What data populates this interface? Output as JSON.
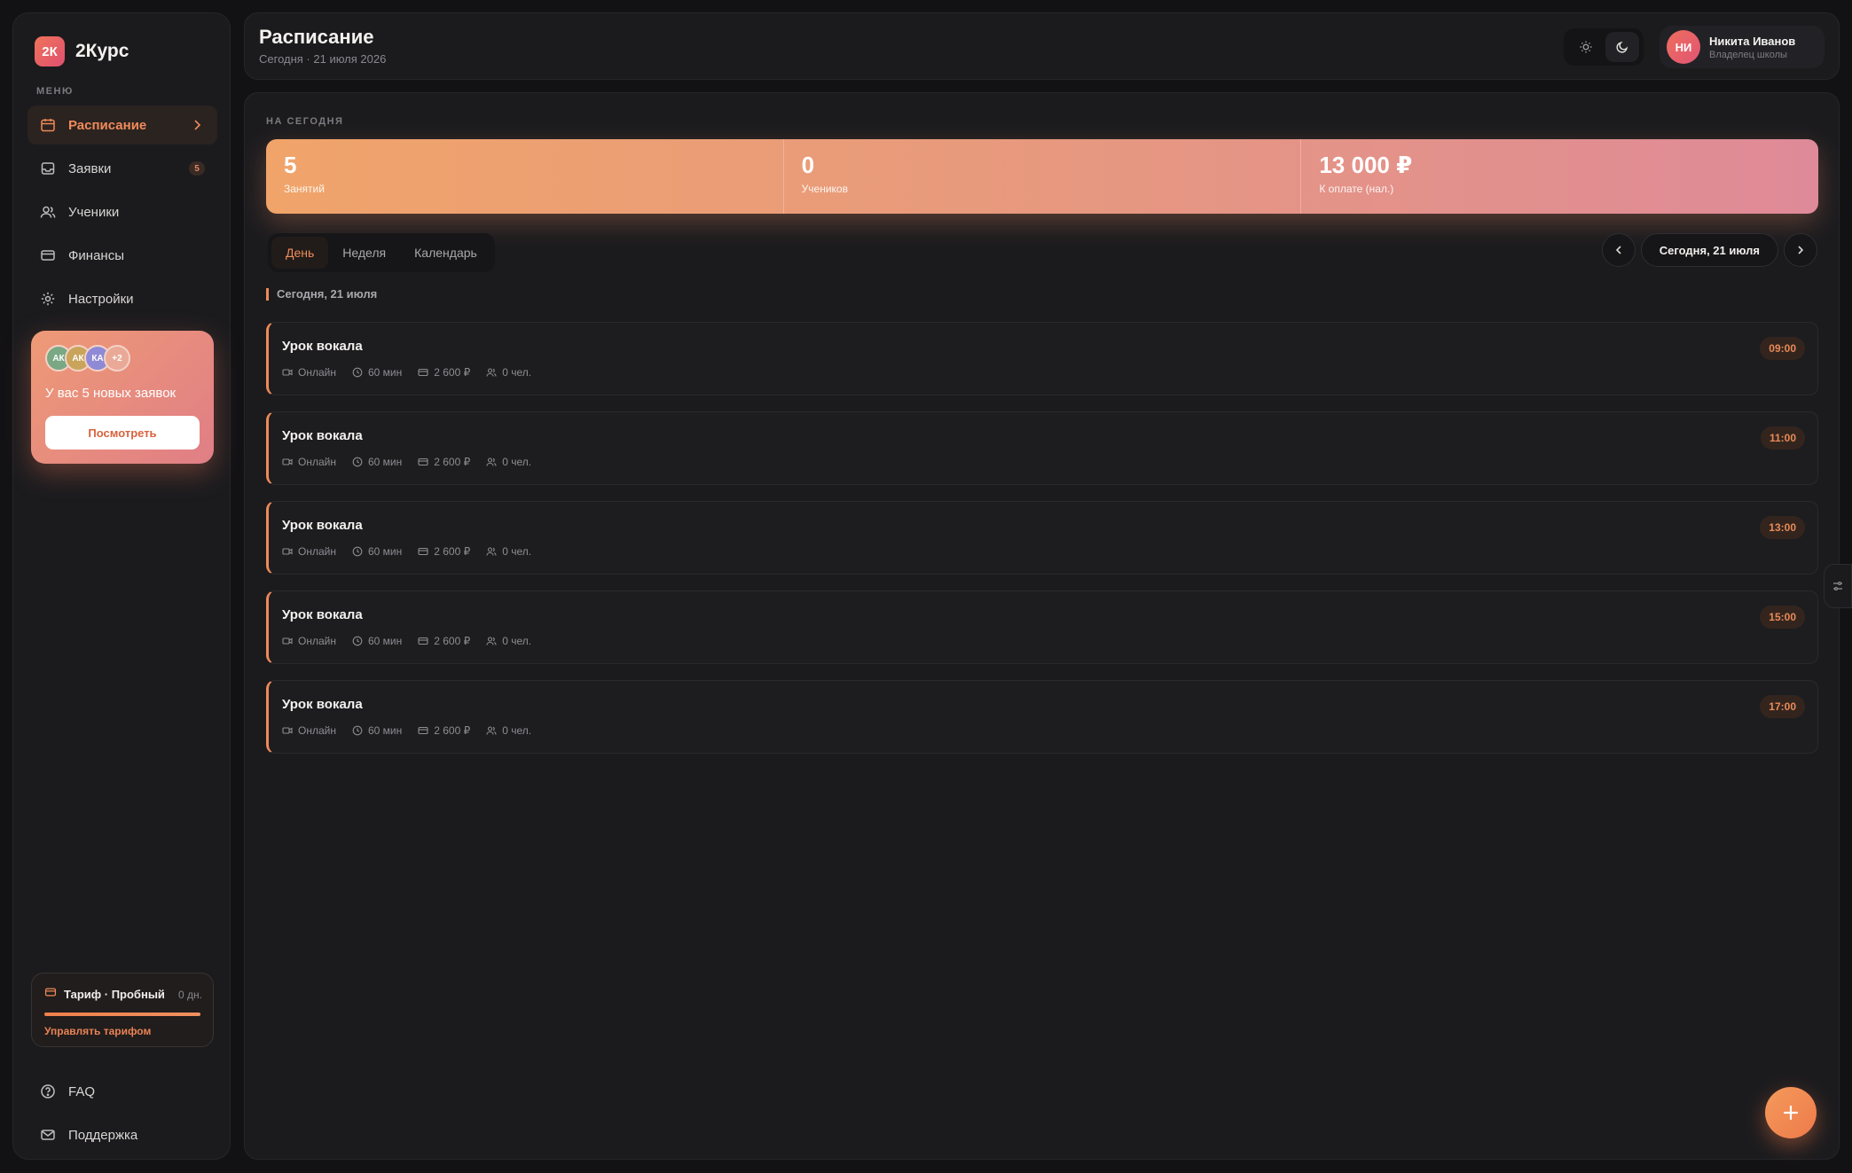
{
  "brand": {
    "logo": "2К",
    "name": "2Курс"
  },
  "sidebar": {
    "menu_caption": "МЕНЮ",
    "items": [
      {
        "label": "Расписание",
        "icon": "calendar-icon",
        "active": true
      },
      {
        "label": "Заявки",
        "icon": "inbox-icon",
        "badge": "5"
      },
      {
        "label": "Ученики",
        "icon": "users-icon"
      },
      {
        "label": "Финансы",
        "icon": "card-icon"
      },
      {
        "label": "Настройки",
        "icon": "gear-icon"
      }
    ],
    "promo": {
      "avatars": [
        "АК",
        "АК",
        "КА",
        "+2"
      ],
      "text": "У вас 5 новых заявок",
      "button": "Посмотреть"
    },
    "plan": {
      "title": "Тариф · Пробный",
      "days": "0 дн.",
      "progress_percent": 100,
      "link": "Управлять тарифом"
    },
    "footer": [
      {
        "label": "FAQ",
        "icon": "help-icon"
      },
      {
        "label": "Поддержка",
        "icon": "mail-icon"
      }
    ]
  },
  "header": {
    "title": "Расписание",
    "subtitle": "Сегодня · 21 июля 2026",
    "user": {
      "initials": "НИ",
      "name": "Никита Иванов",
      "role": "Владелец школы"
    }
  },
  "main": {
    "today_caption": "НА СЕГОДНЯ",
    "stats": [
      {
        "value": "5",
        "label": "Занятий"
      },
      {
        "value": "0",
        "label": "Учеников"
      },
      {
        "value": "13 000 ₽",
        "label": "К оплате (нал.)"
      }
    ],
    "tabs": [
      "День",
      "Неделя",
      "Календарь"
    ],
    "date_pill": "Сегодня, 21 июля",
    "day_label": "Сегодня, 21 июля",
    "lessons": [
      {
        "title": "Урок вокала",
        "format": "Онлайн",
        "duration": "60 мин",
        "price": "2 600 ₽",
        "people": "0 чел.",
        "time": "09:00"
      },
      {
        "title": "Урок вокала",
        "format": "Онлайн",
        "duration": "60 мин",
        "price": "2 600 ₽",
        "people": "0 чел.",
        "time": "11:00"
      },
      {
        "title": "Урок вокала",
        "format": "Онлайн",
        "duration": "60 мин",
        "price": "2 600 ₽",
        "people": "0 чел.",
        "time": "13:00"
      },
      {
        "title": "Урок вокала",
        "format": "Онлайн",
        "duration": "60 мин",
        "price": "2 600 ₽",
        "people": "0 чел.",
        "time": "15:00"
      },
      {
        "title": "Урок вокала",
        "format": "Онлайн",
        "duration": "60 мин",
        "price": "2 600 ₽",
        "people": "0 чел.",
        "time": "17:00"
      }
    ]
  },
  "colors": {
    "accent": "#ef8a58",
    "background": "#121214",
    "panel": "#1b1b1e"
  }
}
